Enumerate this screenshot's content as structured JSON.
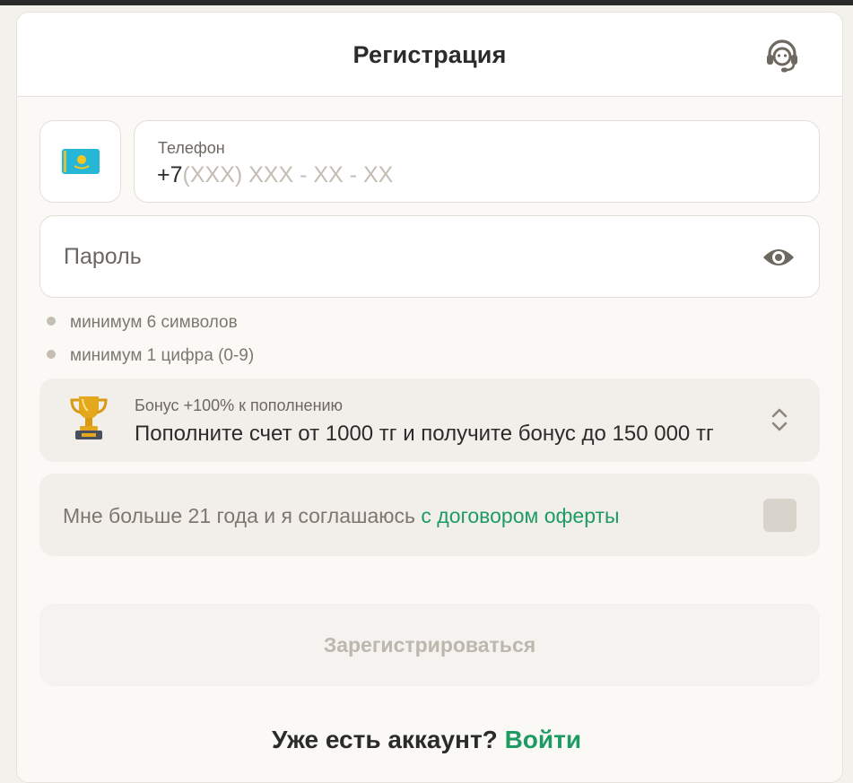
{
  "header": {
    "title": "Регистрация",
    "support_icon": "headset-icon"
  },
  "phone": {
    "country_flag_icon": "kazakhstan-flag-icon",
    "label": "Телефон",
    "prefix": "+7",
    "placeholder": "(XXX) XXX - XX - XX"
  },
  "password": {
    "placeholder": "Пароль",
    "toggle_icon": "eye-icon"
  },
  "password_rules": [
    "минимум 6 символов",
    "минимум 1 цифра (0-9)"
  ],
  "bonus": {
    "icon": "trophy-icon",
    "label": "Бонус +100% к пополнению",
    "text": "Пополните счет от 1000 тг и получите бонус до 150 000 тг",
    "selector_icon": "chevron-up-down-icon"
  },
  "agreement": {
    "text": "Мне больше 21 года и я соглашаюсь ",
    "link": "с договором оферты",
    "checked": false
  },
  "submit_label": "Зарегистрироваться",
  "login": {
    "question": "Уже есть аккаунт? ",
    "link": "Войти"
  },
  "colors": {
    "accent_green": "#1e9b63",
    "background": "#f3f1ec",
    "field_fill": "#f2efea"
  }
}
